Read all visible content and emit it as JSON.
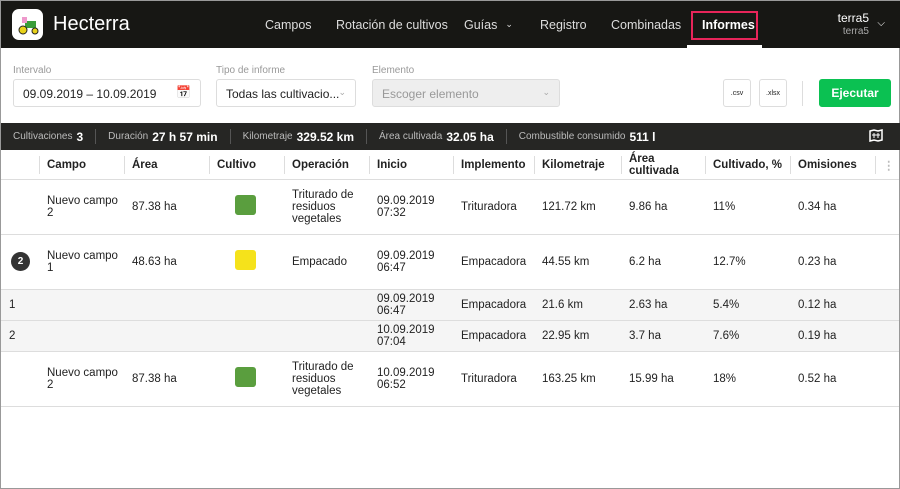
{
  "header": {
    "brand": "Hecterra",
    "nav": [
      "Campos",
      "Rotación de cultivos",
      "Guías",
      "Registro",
      "Combinadas",
      "Informes"
    ],
    "active": "Informes",
    "user": "terra5",
    "account": "terra5"
  },
  "filters": {
    "interval_label": "Intervalo",
    "interval_value": "09.09.2019 – 10.09.2019",
    "type_label": "Tipo de informe",
    "type_value": "Todas las cultivacio...",
    "element_label": "Elemento",
    "element_placeholder": "Escoger elemento",
    "csv": ".csv",
    "xlsx": ".xlsx",
    "run": "Ejecutar"
  },
  "stats": [
    {
      "k": "Cultivaciones",
      "v": "3"
    },
    {
      "k": "Duración",
      "v": "27 h 57 min"
    },
    {
      "k": "Kilometraje",
      "v": "329.52 km"
    },
    {
      "k": "Área cultivada",
      "v": "32.05 ha"
    },
    {
      "k": "Combustible consumido",
      "v": "511 l"
    }
  ],
  "columns": [
    "Campo",
    "Área",
    "Cultivo",
    "Operación",
    "Inicio",
    "Implemento",
    "Kilometraje",
    "Área cultivada",
    "Cultivado, %",
    "Omisiones"
  ],
  "rows": [
    {
      "num": "",
      "campo": "Nuevo campo 2",
      "area": "87.38 ha",
      "color": "#5a9e3e",
      "op": "Triturado de residuos vegetales",
      "inicio_d": "09.09.2019",
      "inicio_t": "07:32",
      "impl": "Trituradora",
      "km": "121.72 km",
      "ac": "9.86 ha",
      "pct": "11%",
      "om": "0.34 ha"
    },
    {
      "num": "2",
      "campo": "Nuevo campo 1",
      "area": "48.63 ha",
      "color": "#f5e21b",
      "op": "Empacado",
      "inicio_d": "09.09.2019",
      "inicio_t": "06:47",
      "impl": "Empacadora",
      "km": "44.55 km",
      "ac": "6.2 ha",
      "pct": "12.7%",
      "om": "0.23 ha"
    },
    {
      "sub": true,
      "idx": "1",
      "inicio_d": "09.09.2019",
      "inicio_t": "06:47",
      "impl": "Empacadora",
      "km": "21.6 km",
      "ac": "2.63 ha",
      "pct": "5.4%",
      "om": "0.12 ha"
    },
    {
      "sub": true,
      "idx": "2",
      "inicio_d": "10.09.2019",
      "inicio_t": "07:04",
      "impl": "Empacadora",
      "km": "22.95 km",
      "ac": "3.7 ha",
      "pct": "7.6%",
      "om": "0.19 ha"
    },
    {
      "num": "",
      "campo": "Nuevo campo 2",
      "area": "87.38 ha",
      "color": "#5a9e3e",
      "op": "Triturado de residuos vegetales",
      "inicio_d": "10.09.2019",
      "inicio_t": "06:52",
      "impl": "Trituradora",
      "km": "163.25 km",
      "ac": "15.99 ha",
      "pct": "18%",
      "om": "0.52 ha"
    }
  ]
}
